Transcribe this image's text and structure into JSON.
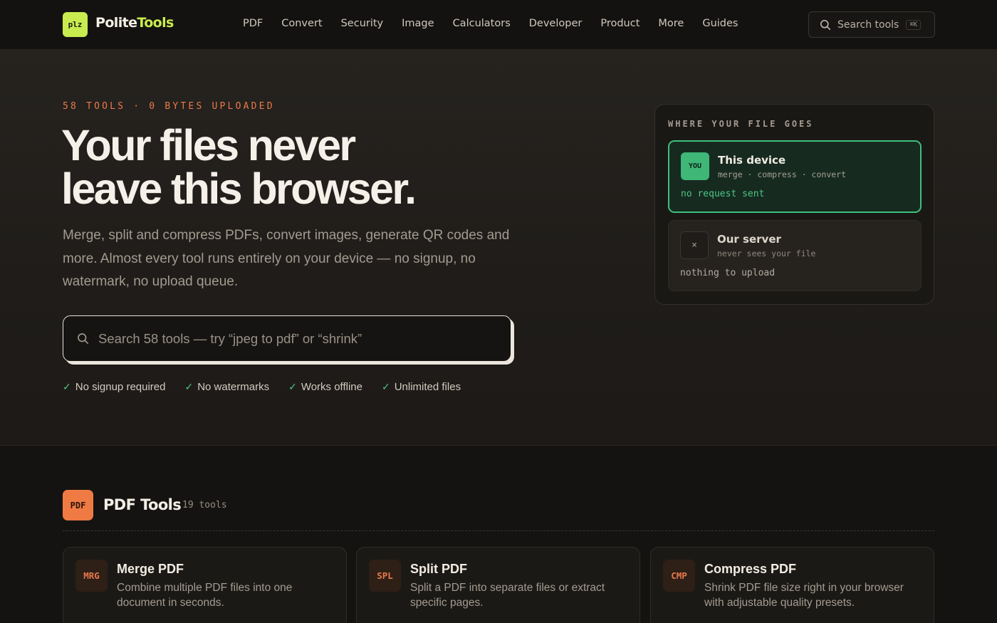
{
  "brand": {
    "badge": "plz",
    "name_part1": "Polite",
    "name_part2": "Tools"
  },
  "nav": {
    "items": [
      "PDF",
      "Convert",
      "Security",
      "Image",
      "Calculators",
      "Developer",
      "Product",
      "More",
      "Guides"
    ],
    "search_label": "Search tools",
    "search_shortcut": "⌘K"
  },
  "hero": {
    "eyebrow": "58 TOOLS · 0 BYTES UPLOADED",
    "headline_line1": "Your files never",
    "headline_line2": "leave this browser.",
    "subtitle": "Merge, split and compress PDFs, convert images, generate QR codes and more. Almost every tool runs entirely on your device — no signup, no watermark, no upload queue.",
    "search_placeholder": "Search 58 tools — try “jpeg to pdf” or “shrink”",
    "checks": [
      "No signup required",
      "No watermarks",
      "Works offline",
      "Unlimited files"
    ]
  },
  "flow": {
    "title": "WHERE YOUR FILE GOES",
    "device": {
      "badge": "YOU",
      "name": "This device",
      "meta": "merge · compress · convert",
      "status": "no request sent"
    },
    "server": {
      "badge": "×",
      "name": "Our server",
      "meta": "never sees your file",
      "status": "nothing to upload"
    }
  },
  "section": {
    "badge": "PDF",
    "title": "PDF Tools",
    "count": "19 tools",
    "cards": [
      {
        "badge": "MRG",
        "title": "Merge PDF",
        "desc": "Combine multiple PDF files into one document in seconds."
      },
      {
        "badge": "SPL",
        "title": "Split PDF",
        "desc": "Split a PDF into separate files or extract specific pages."
      },
      {
        "badge": "CMP",
        "title": "Compress PDF",
        "desc": "Shrink PDF file size right in your browser with adjustable quality presets."
      }
    ]
  },
  "colors": {
    "accent_lime": "#c8ec4f",
    "accent_orange": "#e8794a",
    "accent_green": "#3ec07c"
  }
}
